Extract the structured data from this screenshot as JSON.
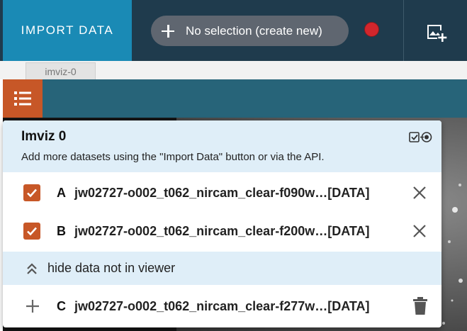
{
  "toolbar": {
    "import_label": "IMPORT DATA",
    "selection_label": "No selection (create new)",
    "record_color": "#d2262c",
    "add_image_icon": "add-image-icon"
  },
  "tabs": [
    {
      "label": "imviz-0"
    }
  ],
  "viewer": {
    "menu_icon": "list-icon",
    "menu_color": "#c75727"
  },
  "data_menu": {
    "title": "Imviz 0",
    "subtitle": "Add more datasets using the \"Import Data\" button or via the API.",
    "in_viewer": [
      {
        "letter": "A",
        "name": "jw02727-o002_t062_nircam_clear-f090w…[DATA]",
        "checked": true
      },
      {
        "letter": "B",
        "name": "jw02727-o002_t062_nircam_clear-f200w…[DATA]",
        "checked": true
      }
    ],
    "toggle_label": "hide data not in viewer",
    "not_in_viewer": [
      {
        "letter": "C",
        "name": "jw02727-o002_t062_nircam_clear-f277w…[DATA]"
      }
    ]
  },
  "colors": {
    "topbar": "#1f3b4d",
    "import_button": "#1a8ab5",
    "accent": "#c75727",
    "viewer_toolbar": "#276479",
    "panel_header": "#dfeef8"
  }
}
